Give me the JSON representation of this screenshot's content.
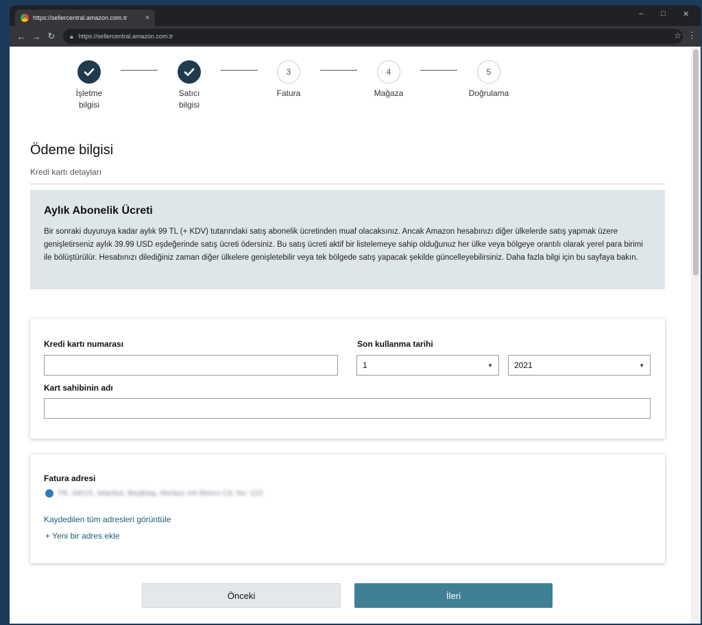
{
  "browser": {
    "tab_title": "https://sellercentral.amazon.com.tr",
    "tab_close": "×",
    "url": "https://sellercentral.amazon.com.tr",
    "controls": {
      "minimize": "–",
      "maximize": "□",
      "close": "✕"
    }
  },
  "stepper": {
    "steps": [
      {
        "label_line1": "İşletme",
        "label_line2": "bilgisi",
        "status": "done",
        "number": ""
      },
      {
        "label_line1": "Satıcı",
        "label_line2": "bilgisi",
        "status": "done",
        "number": ""
      },
      {
        "label_line1": "Fatura",
        "label_line2": "",
        "status": "todo",
        "number": "3"
      },
      {
        "label_line1": "Mağaza",
        "label_line2": "",
        "status": "todo",
        "number": "4"
      },
      {
        "label_line1": "Doğrulama",
        "label_line2": "",
        "status": "todo",
        "number": "5"
      }
    ]
  },
  "section": {
    "title": "Ödeme bilgisi",
    "subtitle": "Kredi kartı detayları"
  },
  "subscription": {
    "title": "Aylık Abonelik Ücreti",
    "body": "Bir sonraki duyuruya kadar aylık 99 TL (+ KDV) tutarındaki satış abonelik ücretinden muaf olacaksınız. Ancak Amazon hesabınızı diğer ülkelerde satış yapmak üzere genişletirseniz aylık 39.99 USD eşdeğerinde satış ücreti ödersiniz. Bu satış ücreti aktif bir listelemeye sahip olduğunuz her ülke veya bölgeye orantılı olarak yerel para birimi ile bölüştürülür. Hesabınızı dilediğiniz zaman diğer ülkelere genişletebilir veya tek bölgede satış yapacak şekilde güncelleyebilirsiniz. Daha fazla bilgi için bu sayfaya bakın."
  },
  "card_form": {
    "card_number_label": "Kredi kartı numarası",
    "card_number_value": "",
    "expiry_label": "Son kullanma tarihi",
    "expiry_month": "1",
    "expiry_year": "2021",
    "holder_label": "Kart sahibinin adı",
    "holder_value": ""
  },
  "billing": {
    "title": "Fatura adresi",
    "address_blurred": "TR, 34015, İstanbul, Beşiktaş, Merkez mh Birinci Cd, No: 123",
    "view_all_link": "Kaydedilen tüm adresleri görüntüle",
    "add_new_link": "+ Yeni bir adres ekle"
  },
  "buttons": {
    "prev": "Önceki",
    "next": "İleri"
  },
  "colors": {
    "step_done": "#1f3b4d",
    "info_box": "#dfe6e9",
    "primary_button": "#3f8096",
    "link": "#1f5a7a"
  }
}
